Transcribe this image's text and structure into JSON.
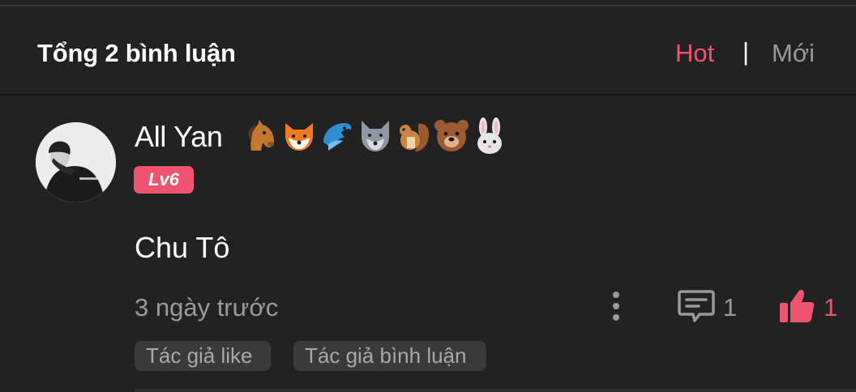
{
  "header": {
    "count_title": "Tổng 2 bình luận",
    "sort_hot": "Hot",
    "sort_separator": "|",
    "sort_new": "Mới",
    "accent_color": "#f0536f"
  },
  "comment": {
    "username": "All Yan",
    "emojis": [
      "horse-face",
      "fox-face",
      "dolphin",
      "wolf-face",
      "chipmunk",
      "bear-face",
      "rabbit-face"
    ],
    "level": "Lv6",
    "text": "Chu Tô",
    "timestamp": "3 ngày trước",
    "reply_count": "1",
    "like_count": "1",
    "tags": [
      "Tác giả like",
      "Tác giả bình luận"
    ]
  }
}
